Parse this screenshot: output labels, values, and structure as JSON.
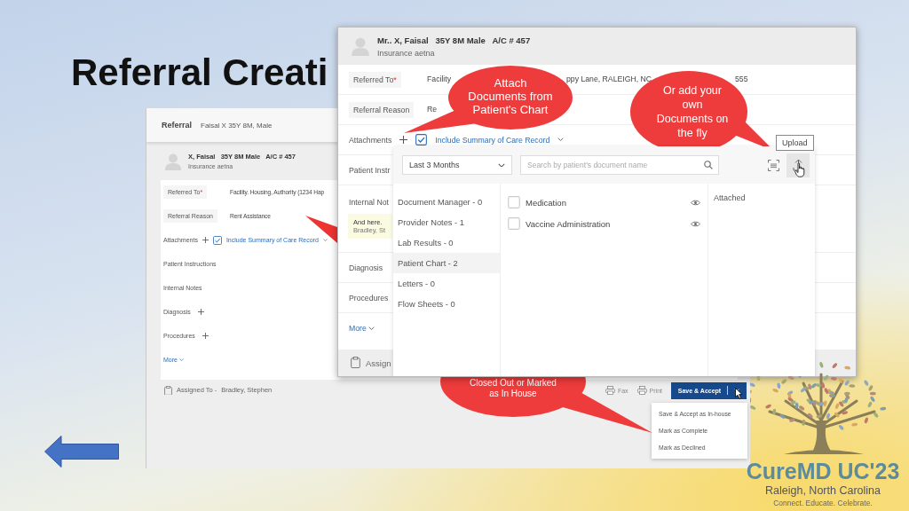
{
  "slide_title": "Referral Creati",
  "back_window": {
    "title": "Referral",
    "subtitle": "Faisal X 35Y 8M, Male",
    "patient": {
      "name": "X, Faisal",
      "age_sex": "35Y 8M Male",
      "account": "A/C # 457",
      "insurance": "Insurance aetna"
    },
    "fields": [
      {
        "kind": "value",
        "label": "Referred To",
        "required_mark": "*",
        "value": "Facility. Housing, Authority (1234 Hap"
      },
      {
        "kind": "value",
        "label": "Referral Reason",
        "value": "Rent Assistance"
      },
      {
        "kind": "attachments",
        "label": "Attachments",
        "checkbox": {
          "label": "Include Summary of Care Record",
          "checked": true
        }
      },
      {
        "kind": "plain",
        "label": "Patient Instructions"
      },
      {
        "kind": "plain",
        "label": "Internal Notes"
      },
      {
        "kind": "add",
        "label": "Diagnosis"
      },
      {
        "kind": "add",
        "label": "Procedures"
      }
    ],
    "more": "More",
    "assigned_label": "Assigned To -",
    "assigned_to": "Bradley, Stephen",
    "actions": [
      "Fax",
      "Print"
    ],
    "primary_button": "Save & Accept",
    "menu": [
      "Save & Accept as In-house",
      "Mark as Complete",
      "Mark as Declined"
    ]
  },
  "front_window": {
    "patient": {
      "name": "Mr.. X, Faisal",
      "age_sex": "35Y 8M Male",
      "account": "A/C # 457",
      "insurance": "Insurance aetna"
    },
    "fields": [
      {
        "kind": "fragments",
        "label": "Referred To",
        "required_mark": "*",
        "fragments": [
          "Facility",
          "ppy Lane, RALEIGH, NC",
          "555"
        ]
      },
      {
        "kind": "fragments",
        "label": "Referral Reason",
        "fragments": [
          "Re"
        ]
      },
      {
        "kind": "attachments",
        "label": "Attachments",
        "checkbox": {
          "label": "Include Summary of Care Record",
          "checked": true
        }
      },
      {
        "kind": "plain",
        "label": "Patient Instr"
      },
      {
        "kind": "note",
        "label": "Internal Not",
        "note": {
          "text": "And here.",
          "author": "Bradley, St"
        }
      },
      {
        "kind": "plain",
        "label": "Diagnosis"
      },
      {
        "kind": "plain",
        "label": "Procedures"
      }
    ],
    "more": "More",
    "assign": "Assign",
    "picker": {
      "range": "Last 3 Months",
      "search_placeholder": "Search by patient's document name",
      "tooltip": "Upload",
      "categories": [
        {
          "label": "Document Manager - 0",
          "selected": false
        },
        {
          "label": "Provider Notes - 1",
          "selected": false
        },
        {
          "label": "Lab Results - 0",
          "selected": false
        },
        {
          "label": "Patient Chart - 2",
          "selected": true
        },
        {
          "label": "Letters - 0",
          "selected": false
        },
        {
          "label": "Flow Sheets - 0",
          "selected": false
        }
      ],
      "documents": [
        {
          "label": "Medication",
          "checked": false
        },
        {
          "label": "Vaccine Administration",
          "checked": false
        }
      ],
      "attached_heading": "Attached"
    }
  },
  "callouts": [
    {
      "text": "Attach\nDocuments from\nPatient's Chart"
    },
    {
      "text": "Or add your\nown\nDocuments on\nthe fly"
    },
    {
      "text": "Closed Out or Marked\nas In House"
    }
  ],
  "logo": {
    "name": "CureMD UC'23",
    "place": "Raleigh, North Carolina",
    "tagline": "Connect. Educate. Celebrate."
  }
}
